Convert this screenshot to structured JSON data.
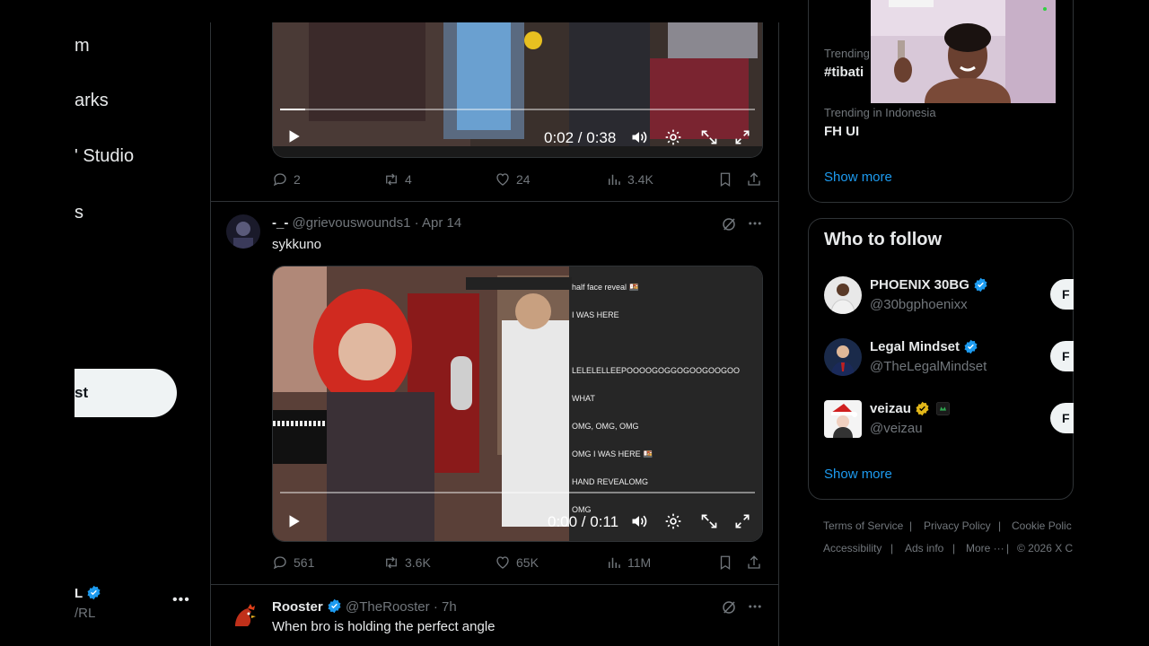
{
  "nav": {
    "items": [
      {
        "label": "m"
      },
      {
        "label": "arks"
      },
      {
        "label": "' Studio"
      },
      {
        "label": "s"
      }
    ],
    "post_label": "st",
    "account": {
      "name": "L",
      "handle": "/RL",
      "more": "•••"
    }
  },
  "tweets": [
    {
      "video": {
        "time": "0:02 / 0:38",
        "progress": 0.053
      },
      "stats": {
        "replies": "2",
        "reposts": "4",
        "likes": "24",
        "views": "3.4K"
      }
    },
    {
      "display_name": "-_-",
      "handle": "@grievouswounds1",
      "date": "Apr 14",
      "separator": "·",
      "text": "sykkuno",
      "video": {
        "time": "0:00 / 0:11",
        "progress": 0.0
      },
      "stats": {
        "replies": "561",
        "reposts": "3.6K",
        "likes": "65K",
        "views": "11M"
      }
    },
    {
      "display_name": "Rooster",
      "handle": "@TheRooster",
      "date": "7h",
      "separator": "·",
      "text": "When bro is holding the perfect angle"
    }
  ],
  "stream_chat": [
    "half face reveal 🍱",
    "I WAS HERE",
    "LELELELLEEPOOOOGOGGOGOOGOOGOO",
    "WHAT",
    "OMG, OMG, OMG",
    "OMG I WAS HERE 🍱",
    "HAND REVEALOMG",
    "OMG"
  ],
  "trends": [
    {
      "label": "Trending",
      "name": "#tibati"
    },
    {
      "label": "Trending in Indonesia",
      "name": "FH UI"
    }
  ],
  "trends_show_more": "Show more",
  "who_to_follow": {
    "title": "Who to follow",
    "users": [
      {
        "name": "PHOENIX 30BG",
        "handle": "@30bgphoenixx",
        "follow": "F"
      },
      {
        "name": "Legal Mindset",
        "handle": "@TheLegalMindset",
        "follow": "F"
      },
      {
        "name": "veizau",
        "handle": "@veizau",
        "follow": "F"
      }
    ],
    "show_more": "Show more"
  },
  "footer": {
    "terms": "Terms of Service",
    "privacy": "Privacy Policy",
    "cookie": "Cookie Polic",
    "accessibility": "Accessibility",
    "ads": "Ads info",
    "more": "More ···",
    "copyright": "© 2026 X C",
    "sep": "|"
  },
  "colors": {
    "accent": "#1d9bf0",
    "verified_gold": "#e2b719",
    "border": "#2f3336",
    "muted": "#71767b"
  }
}
